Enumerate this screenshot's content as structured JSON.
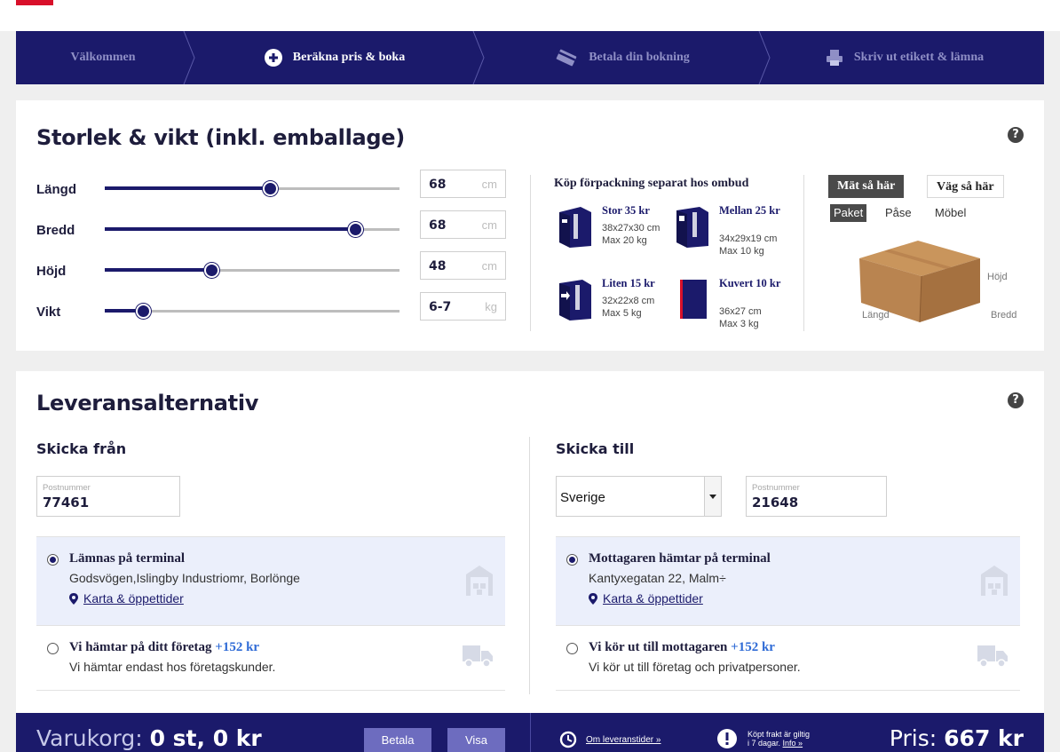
{
  "steps": [
    {
      "label": "Välkommen",
      "active": false
    },
    {
      "label": "Beräkna pris & boka",
      "active": true
    },
    {
      "label": "Betala din bokning",
      "active": false
    },
    {
      "label": "Skriv ut etikett & lämna",
      "active": false
    }
  ],
  "size_card": {
    "title": "Storlek & vikt (inkl. emballage)",
    "help": "?",
    "sliders": [
      {
        "label": "Längd",
        "value": "68",
        "unit": "cm",
        "level": 0.56
      },
      {
        "label": "Bredd",
        "value": "68",
        "unit": "cm",
        "level": 0.85
      },
      {
        "label": "Höjd",
        "value": "48",
        "unit": "cm",
        "level": 0.36
      },
      {
        "label": "Vikt",
        "value": "6-7",
        "unit": "kg",
        "level": 0.13
      }
    ],
    "packaging": {
      "title": "Köp förpackning separat hos ombud",
      "items": [
        {
          "name": "Stor 35 kr",
          "dims": "38x27x30 cm",
          "weight": "Max 20 kg"
        },
        {
          "name": "Mellan 25 kr",
          "dims": "34x29x19 cm",
          "weight": "Max 10 kg"
        },
        {
          "name": "Liten 15 kr",
          "dims": "32x22x8 cm",
          "weight": "Max 5 kg"
        },
        {
          "name": "Kuvert 10 kr",
          "dims": "36x27 cm",
          "weight": "Max 3 kg"
        }
      ]
    },
    "measure": {
      "tab_measure": "Mät så här",
      "tab_weigh": "Väg så här",
      "subtabs": [
        "Paket",
        "Påse",
        "Möbel"
      ],
      "labels": {
        "length": "Längd",
        "width": "Bredd",
        "height": "Höjd"
      }
    }
  },
  "delivery_card": {
    "title": "Leveransalternativ",
    "help": "?",
    "from": {
      "title": "Skicka från",
      "postcode_placeholder": "Postnummer",
      "postcode": "77461",
      "option1": {
        "title": "Lämnas på terminal",
        "address": "Godsvögen,Islingby Industriomr, Borlönge",
        "link": "Karta & öppettider"
      },
      "option2": {
        "title": "Vi hämtar på ditt företag",
        "extra": "+152 kr",
        "note": "Vi hämtar endast hos företagskunder."
      }
    },
    "to": {
      "title": "Skicka till",
      "country": "Sverige",
      "postcode_placeholder": "Postnummer",
      "postcode": "21648",
      "option1": {
        "title": "Mottagaren hämtar på terminal",
        "address": "Kantyxegatan 22, Malm÷",
        "link": "Karta & öppettider"
      },
      "option2": {
        "title": "Vi kör ut till mottagaren",
        "extra": "+152 kr",
        "note": "Vi kör ut till företag och privatpersoner."
      }
    }
  },
  "bottom": {
    "cart_label": "Varukorg:",
    "cart_value": "0 st, 0 kr",
    "pay": "Betala",
    "show": "Visa",
    "delivery_times": "Om leveranstider »",
    "note_line1": "Köpt frakt är giltig",
    "note_line2": "i 7 dagar.",
    "note_link": "Info »",
    "price_label": "Pris:",
    "price_value": "667 kr"
  }
}
